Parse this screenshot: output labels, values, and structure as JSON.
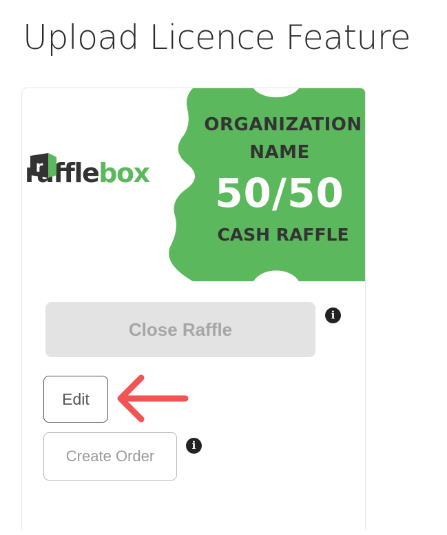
{
  "page": {
    "title": "Upload Licence Feature"
  },
  "ticket": {
    "logo_part1": "raffle",
    "logo_part2": "box",
    "logo_mark_letter": "r",
    "org_line1": "ORGANIZATION",
    "org_line2": "NAME",
    "headline": "50/50",
    "subtitle": "CASH RAFFLE",
    "colors": {
      "green": "#5cb85c",
      "dark_text": "#333333"
    }
  },
  "actions": {
    "close_raffle_label": "Close Raffle",
    "edit_label": "Edit",
    "create_order_label": "Create Order",
    "info_glyph": "i"
  },
  "annotation": {
    "arrow_color": "#f05454",
    "arrow_icon": "left-arrow-icon"
  }
}
